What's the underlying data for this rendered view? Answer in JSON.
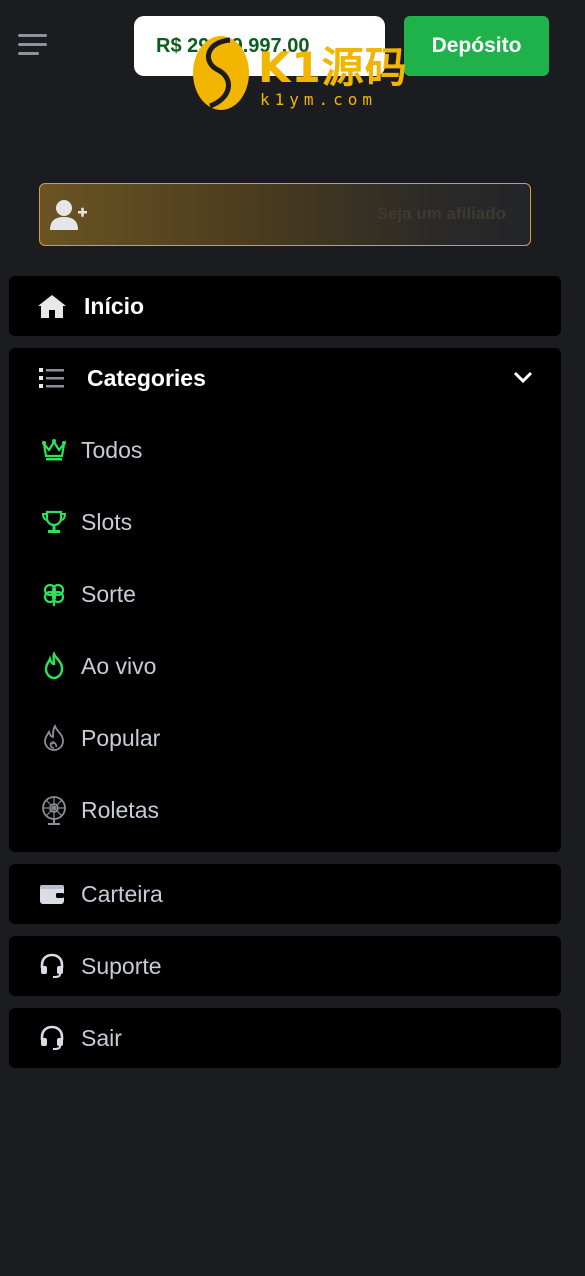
{
  "header": {
    "balance": "R$ 29999.997,00",
    "deposit_label": "Depósito"
  },
  "watermark": {
    "brand": "K1源码",
    "url": "k1ym.com"
  },
  "affiliate": {
    "label": "Seja um afiliado"
  },
  "menu": {
    "home_label": "Início",
    "categories_label": "Categories",
    "categories": [
      {
        "label": "Todos",
        "icon": "crown-icon"
      },
      {
        "label": "Slots",
        "icon": "trophy-icon"
      },
      {
        "label": "Sorte",
        "icon": "clover-icon"
      },
      {
        "label": "Ao vivo",
        "icon": "fire-icon"
      },
      {
        "label": "Popular",
        "icon": "flame-icon"
      },
      {
        "label": "Roletas",
        "icon": "roulette-icon"
      }
    ],
    "wallet_label": "Carteira",
    "support_label": "Suporte",
    "logout_label": "Sair"
  },
  "colors": {
    "background": "#1b1c20",
    "card": "#000000",
    "accent_green": "#1fb24a",
    "icon_green": "#2ee05a",
    "gold": "#d2a32a"
  }
}
